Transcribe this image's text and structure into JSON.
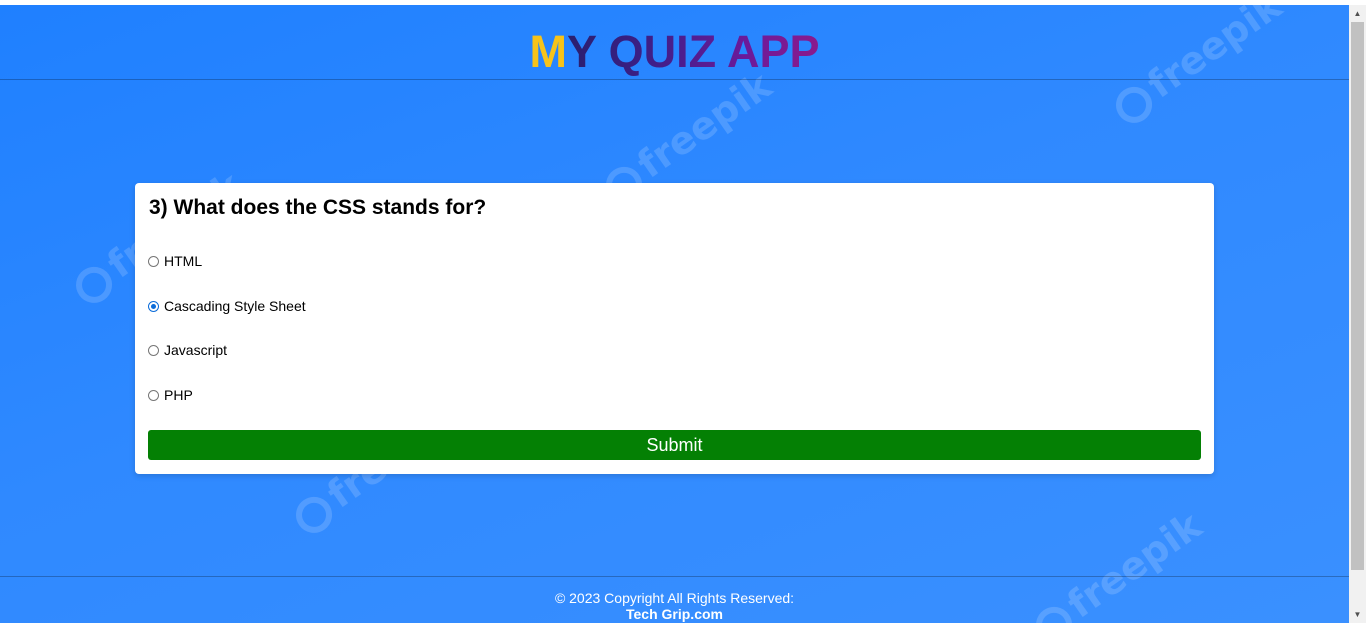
{
  "header": {
    "title_first_letter": "M",
    "title_rest": "Y QUIZ APP"
  },
  "quiz": {
    "question": "3) What does the CSS stands for?",
    "options": [
      {
        "label": "HTML",
        "selected": false
      },
      {
        "label": "Cascading Style Sheet",
        "selected": true
      },
      {
        "label": "Javascript",
        "selected": false
      },
      {
        "label": "PHP",
        "selected": false
      }
    ],
    "submit_label": "Submit"
  },
  "footer": {
    "copyright": "© 2023 Copyright All Rights Reserved:",
    "brand": "Tech Grip.com"
  },
  "watermark": "freepik",
  "colors": {
    "background": "#2a86ff",
    "title_accent": "#f7c31a",
    "title_gradient": "#3b1f86",
    "submit": "#048004",
    "radio_selected": "#0b6cd9"
  },
  "icons": [
    "scroll-up-arrow-icon",
    "scroll-down-arrow-icon"
  ]
}
